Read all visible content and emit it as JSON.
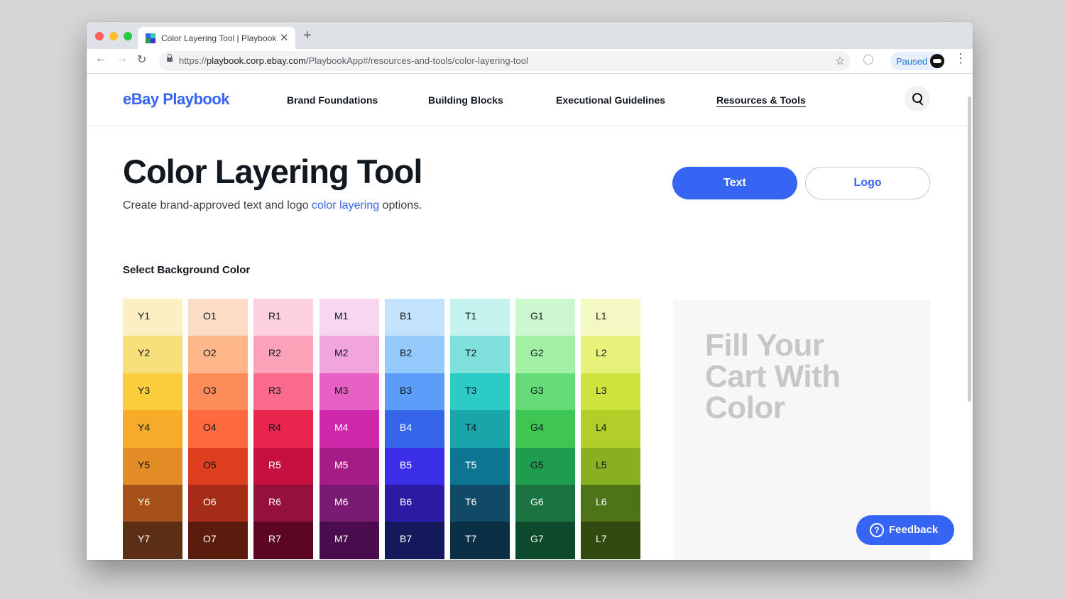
{
  "browser": {
    "tab_title": "Color Layering Tool | Playbook",
    "tab_close": "✕",
    "new_tab": "+",
    "back": "←",
    "forward": "→",
    "reload": "↻",
    "url_scheme": "https://",
    "url_host": "playbook.corp.ebay.com",
    "url_path": "/PlaybookApp#/resources-and-tools/color-layering-tool",
    "bookmark": "☆",
    "profile_status": "Paused",
    "menu": "⋮"
  },
  "header": {
    "logo": "eBay Playbook",
    "nav": [
      "Brand Foundations",
      "Building Blocks",
      "Executional Guidelines",
      "Resources & Tools"
    ],
    "active_nav": "Resources & Tools"
  },
  "page": {
    "title": "Color Layering Tool",
    "subtitle_before": "Create brand-approved text and logo ",
    "subtitle_link": "color layering",
    "subtitle_after": " options.",
    "mode_buttons": {
      "text": "Text",
      "logo": "Logo"
    },
    "selected_mode": "Text",
    "section_label": "Select Background Color",
    "preview_text": [
      "Fill Your",
      "Cart With",
      "Color"
    ],
    "feedback": {
      "icon": "?",
      "label": "Feedback"
    }
  },
  "palette": [
    {
      "family": "Y",
      "swatches": [
        {
          "label": "Y1",
          "color": "#fcefc2",
          "text": "#111820"
        },
        {
          "label": "Y2",
          "color": "#f7e07c",
          "text": "#111820"
        },
        {
          "label": "Y3",
          "color": "#fbcd3b",
          "text": "#111820"
        },
        {
          "label": "Y4",
          "color": "#f6ac28",
          "text": "#111820"
        },
        {
          "label": "Y5",
          "color": "#e38b25",
          "text": "#111820"
        },
        {
          "label": "Y6",
          "color": "#a65019",
          "text": "#ffffff"
        },
        {
          "label": "Y7",
          "color": "#5c2e16",
          "text": "#ffffff"
        }
      ]
    },
    {
      "family": "O",
      "swatches": [
        {
          "label": "O1",
          "color": "#fddcc5",
          "text": "#111820"
        },
        {
          "label": "O2",
          "color": "#feb78a",
          "text": "#111820"
        },
        {
          "label": "O3",
          "color": "#fe8c5b",
          "text": "#111820"
        },
        {
          "label": "O4",
          "color": "#fe6a3d",
          "text": "#111820"
        },
        {
          "label": "O5",
          "color": "#dd3e1e",
          "text": "#111820"
        },
        {
          "label": "O6",
          "color": "#a52c16",
          "text": "#ffffff"
        },
        {
          "label": "O7",
          "color": "#5a1d0d",
          "text": "#ffffff"
        }
      ]
    },
    {
      "family": "R",
      "swatches": [
        {
          "label": "R1",
          "color": "#fdd0de",
          "text": "#111820"
        },
        {
          "label": "R2",
          "color": "#fba2b8",
          "text": "#111820"
        },
        {
          "label": "R3",
          "color": "#fb6a8b",
          "text": "#111820"
        },
        {
          "label": "R4",
          "color": "#e8264b",
          "text": "#111820"
        },
        {
          "label": "R5",
          "color": "#c50f3e",
          "text": "#ffffff"
        },
        {
          "label": "R6",
          "color": "#95103a",
          "text": "#ffffff"
        },
        {
          "label": "R7",
          "color": "#5c0625",
          "text": "#ffffff"
        }
      ]
    },
    {
      "family": "M",
      "swatches": [
        {
          "label": "M1",
          "color": "#f7d6ef",
          "text": "#111820"
        },
        {
          "label": "M2",
          "color": "#f2a5dd",
          "text": "#111820"
        },
        {
          "label": "M3",
          "color": "#e561c4",
          "text": "#111820"
        },
        {
          "label": "M4",
          "color": "#cc28a9",
          "text": "#ffffff"
        },
        {
          "label": "M5",
          "color": "#a51c87",
          "text": "#ffffff"
        },
        {
          "label": "M6",
          "color": "#7a1b73",
          "text": "#ffffff"
        },
        {
          "label": "M7",
          "color": "#4a0c4d",
          "text": "#ffffff"
        }
      ]
    },
    {
      "family": "B",
      "swatches": [
        {
          "label": "B1",
          "color": "#c2e3fb",
          "text": "#111820"
        },
        {
          "label": "B2",
          "color": "#94c9fb",
          "text": "#111820"
        },
        {
          "label": "B3",
          "color": "#5d9dfa",
          "text": "#111820"
        },
        {
          "label": "B4",
          "color": "#3566e9",
          "text": "#ffffff"
        },
        {
          "label": "B5",
          "color": "#3a2ee6",
          "text": "#ffffff"
        },
        {
          "label": "B6",
          "color": "#2b1ba4",
          "text": "#ffffff"
        },
        {
          "label": "B7",
          "color": "#14195b",
          "text": "#ffffff"
        }
      ]
    },
    {
      "family": "T",
      "swatches": [
        {
          "label": "T1",
          "color": "#c4f2ee",
          "text": "#111820"
        },
        {
          "label": "T2",
          "color": "#7fe0dc",
          "text": "#111820"
        },
        {
          "label": "T3",
          "color": "#2dcbc6",
          "text": "#111820"
        },
        {
          "label": "T4",
          "color": "#19a5aa",
          "text": "#111820"
        },
        {
          "label": "T5",
          "color": "#0c7691",
          "text": "#ffffff"
        },
        {
          "label": "T6",
          "color": "#104a66",
          "text": "#ffffff"
        },
        {
          "label": "T7",
          "color": "#0b2f45",
          "text": "#ffffff"
        }
      ]
    },
    {
      "family": "G",
      "swatches": [
        {
          "label": "G1",
          "color": "#cdf7cd",
          "text": "#111820"
        },
        {
          "label": "G2",
          "color": "#a2f0a4",
          "text": "#111820"
        },
        {
          "label": "G3",
          "color": "#64db76",
          "text": "#111820"
        },
        {
          "label": "G4",
          "color": "#3ec653",
          "text": "#111820"
        },
        {
          "label": "G5",
          "color": "#1f9c4e",
          "text": "#111820"
        },
        {
          "label": "G6",
          "color": "#19743f",
          "text": "#ffffff"
        },
        {
          "label": "G7",
          "color": "#0d4a2b",
          "text": "#ffffff"
        }
      ]
    },
    {
      "family": "L",
      "swatches": [
        {
          "label": "L1",
          "color": "#f4f8c3",
          "text": "#111820"
        },
        {
          "label": "L2",
          "color": "#e7f27a",
          "text": "#111820"
        },
        {
          "label": "L3",
          "color": "#cde33e",
          "text": "#111820"
        },
        {
          "label": "L4",
          "color": "#b1cf28",
          "text": "#111820"
        },
        {
          "label": "L5",
          "color": "#88b021",
          "text": "#111820"
        },
        {
          "label": "L6",
          "color": "#4d7419",
          "text": "#ffffff"
        },
        {
          "label": "L7",
          "color": "#314a10",
          "text": "#ffffff"
        }
      ]
    }
  ],
  "colors": {
    "accent": "#3665f3",
    "heading": "#111820"
  }
}
